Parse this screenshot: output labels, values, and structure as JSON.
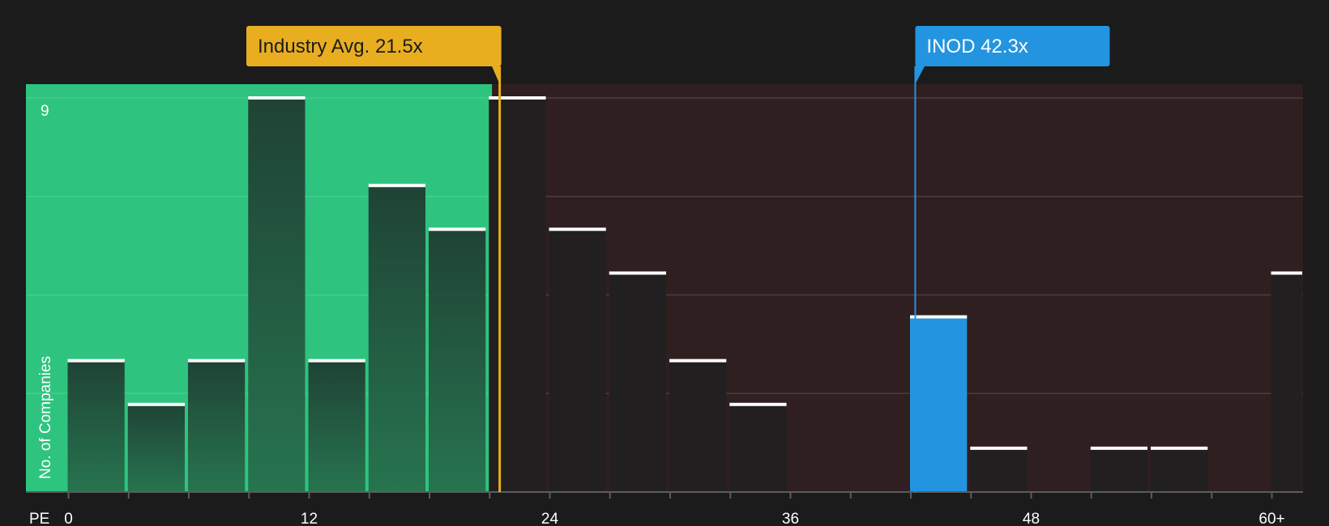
{
  "chart_data": {
    "type": "bar",
    "xlabel": "PE",
    "ylabel": "No. of Companies",
    "x_ticks": [
      "0",
      "12",
      "24",
      "36",
      "48",
      "60+"
    ],
    "x_tick_values": [
      0,
      12,
      24,
      36,
      48,
      60
    ],
    "x_range": [
      0,
      61
    ],
    "ylim": [
      0,
      9
    ],
    "y_tick_labels": [
      "9"
    ],
    "grid": true,
    "bin_width": 3,
    "bins": [
      {
        "start": 0,
        "count": 3
      },
      {
        "start": 3,
        "count": 2
      },
      {
        "start": 6,
        "count": 3
      },
      {
        "start": 9,
        "count": 9
      },
      {
        "start": 12,
        "count": 3
      },
      {
        "start": 15,
        "count": 7
      },
      {
        "start": 18,
        "count": 6
      },
      {
        "start": 21,
        "count": 9
      },
      {
        "start": 24,
        "count": 6
      },
      {
        "start": 27,
        "count": 5
      },
      {
        "start": 30,
        "count": 3
      },
      {
        "start": 33,
        "count": 2
      },
      {
        "start": 36,
        "count": 0
      },
      {
        "start": 39,
        "count": 0
      },
      {
        "start": 42,
        "count": 4,
        "highlight": true
      },
      {
        "start": 45,
        "count": 1
      },
      {
        "start": 48,
        "count": 0
      },
      {
        "start": 51,
        "count": 1
      },
      {
        "start": 54,
        "count": 1
      },
      {
        "start": 57,
        "count": 0
      },
      {
        "start": 60,
        "count": 5
      }
    ],
    "markers": {
      "industry": {
        "label": "Industry Avg. 21.5x",
        "value": 21.5,
        "color": "#e9ae1f"
      },
      "company": {
        "label": "INOD 42.3x",
        "value": 42.3,
        "color": "#2394e0"
      }
    },
    "colors": {
      "background": "#1b1b1b",
      "undervalued_region": "#2ec47f",
      "overvalued_region": "#2f1f20",
      "bar_in_green": "#22473a",
      "bar_in_red": "#221f20",
      "highlight_bar": "#2394e0",
      "bar_cap": "#ffffff"
    }
  }
}
